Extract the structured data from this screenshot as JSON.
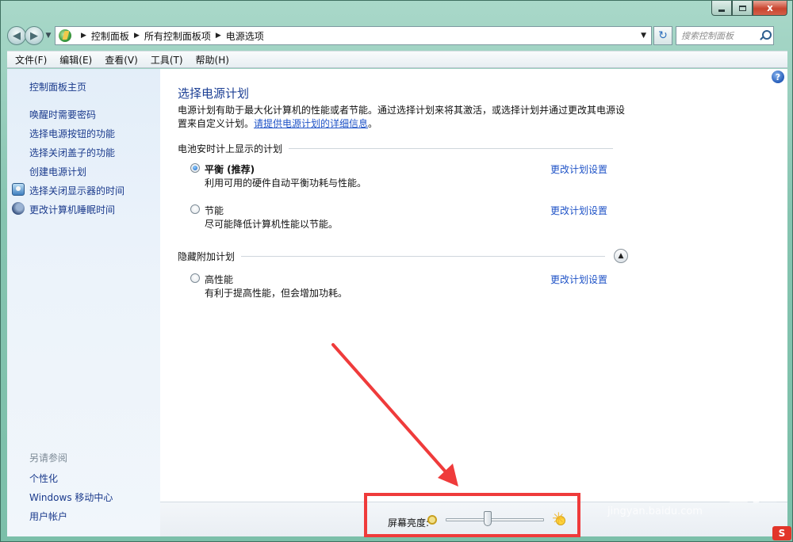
{
  "window": {
    "close_glyph": "x"
  },
  "navigation": {
    "breadcrumbs": [
      "控制面板",
      "所有控制面板项",
      "电源选项"
    ],
    "search_placeholder": "搜索控制面板"
  },
  "menu": [
    "文件(F)",
    "编辑(E)",
    "查看(V)",
    "工具(T)",
    "帮助(H)"
  ],
  "sidebar": {
    "home": "控制面板主页",
    "links": [
      "唤醒时需要密码",
      "选择电源按钮的功能",
      "选择关闭盖子的功能",
      "创建电源计划",
      "选择关闭显示器的时间",
      "更改计算机睡眠时间"
    ],
    "see_also_title": "另请参阅",
    "see_also": [
      "个性化",
      "Windows 移动中心",
      "用户帐户"
    ]
  },
  "main": {
    "title": "选择电源计划",
    "description": "电源计划有助于最大化计算机的性能或者节能。通过选择计划来将其激活，或选择计划并通过更改其电源设置来自定义计划。",
    "description_link": "请提供电源计划的详细信息",
    "description_end": "。",
    "battery_group": "电池安时计上显示的计划",
    "hidden_group": "隐藏附加计划",
    "change_link": "更改计划设置",
    "plans": [
      {
        "name": "平衡 (推荐)",
        "desc": "利用可用的硬件自动平衡功耗与性能。",
        "selected": true
      },
      {
        "name": "节能",
        "desc": "尽可能降低计算机性能以节能。",
        "selected": false
      },
      {
        "name": "高性能",
        "desc": "有利于提高性能，但会增加功耗。",
        "selected": false
      }
    ]
  },
  "brightness": {
    "label": "屏幕亮度:",
    "level_percent": 42
  },
  "annotation": {
    "color": "#ef3b3b"
  },
  "watermark": {
    "main": "Bai du 经验",
    "sub": "jingyan.baidu.com",
    "corner": "S"
  }
}
